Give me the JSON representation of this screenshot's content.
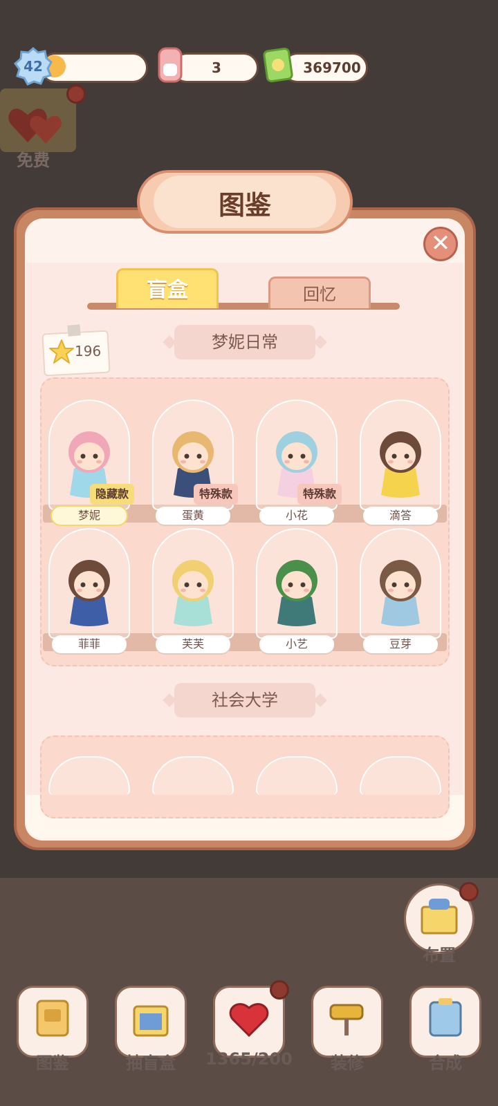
{
  "hud": {
    "level": "42",
    "xp_progress": 0.22,
    "energy": "3",
    "coins": "369700"
  },
  "side": {
    "free_label": "免费"
  },
  "modal": {
    "title": "图鉴",
    "close_icon": "close-icon",
    "tabs": [
      {
        "label": "盲盒",
        "active": true
      },
      {
        "label": "回忆",
        "active": false
      }
    ],
    "star_count": "196",
    "sections": [
      {
        "title": "梦妮日常",
        "items": [
          {
            "name": "梦妮",
            "tag": "隐藏款",
            "tag_color": "#f6dd7a",
            "hair": "#f0a8b8",
            "outfit": "#9fd8e8"
          },
          {
            "name": "蛋黄",
            "tag": "特殊款",
            "tag_color": "#f7c7bb",
            "hair": "#e8b870",
            "outfit": "#3a4f7a"
          },
          {
            "name": "小花",
            "tag": "特殊款",
            "tag_color": "#f7c7bb",
            "hair": "#9fd0e0",
            "outfit": "#f5d0e0"
          },
          {
            "name": "滴答",
            "tag": "",
            "tag_color": "",
            "hair": "#6e4a3a",
            "outfit": "#f5d34c"
          },
          {
            "name": "菲菲",
            "tag": "",
            "tag_color": "",
            "hair": "#6e4a3a",
            "outfit": "#3f5ea8"
          },
          {
            "name": "芙芙",
            "tag": "",
            "tag_color": "",
            "hair": "#f0d070",
            "outfit": "#a8e0d8"
          },
          {
            "name": "小艺",
            "tag": "",
            "tag_color": "",
            "hair": "#4a8f4a",
            "outfit": "#3f7a78"
          },
          {
            "name": "豆芽",
            "tag": "",
            "tag_color": "",
            "hair": "#7a5a44",
            "outfit": "#9fc9e0"
          }
        ]
      },
      {
        "title": "社会大学",
        "items": []
      }
    ]
  },
  "setup_label": "布置",
  "bottom_nav": [
    {
      "label": "图鉴",
      "icon": "book-icon"
    },
    {
      "label": "抽盲盒",
      "icon": "blind-box-icon"
    },
    {
      "label": "1365/200",
      "icon": "heart-icon"
    },
    {
      "label": "装修",
      "icon": "paint-roller-icon"
    },
    {
      "label": "合成",
      "icon": "clipboard-icon"
    }
  ],
  "colors": {
    "accent": "#c98662",
    "tab_active": "#ffe072",
    "panel": "#fde9e4"
  }
}
